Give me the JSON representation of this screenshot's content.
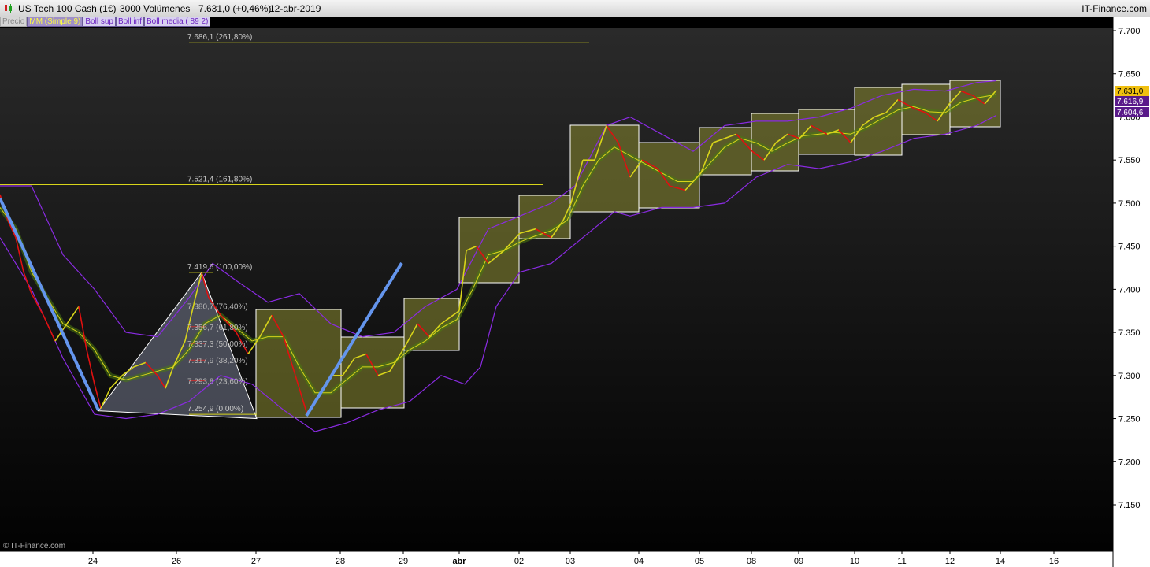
{
  "header": {
    "instrument": "US Tech 100 Cash (1€)",
    "volume": "3000 Volúmenes",
    "price_change": "7.631,0 (+0,46%)",
    "date": "12-abr-2019",
    "brand": "IT-Finance.com"
  },
  "legend": [
    "Precio",
    "MM (Simple 9)",
    "Boll sup",
    "Boll inf",
    "Boll media ( 89 2)"
  ],
  "watermark": "© IT-Finance.com",
  "price_tags": {
    "last": "7.631,0",
    "upper": "7.616,9",
    "lower": "7.604,6"
  },
  "colors": {
    "background_top": "#262626",
    "background_bottom": "#020202",
    "price_up": "#d8d41a",
    "price_down": "#e01010",
    "sma": "#d8d41a",
    "bollinger": "#8a2be2",
    "trend_lines": "#6495ed",
    "boxes_fill": "#8a8a30",
    "fib_line": "#d8d41a"
  },
  "fibonacci": {
    "main_levels": [
      {
        "label": "7.686,1 (261,80%)",
        "value": 7686.1
      },
      {
        "label": "7.521,4 (161,80%)",
        "value": 7521.4
      },
      {
        "label": "7.419,6 (100,00%)",
        "value": 7419.6
      },
      {
        "label": "7.254,9 (0,00%)",
        "value": 7254.9
      }
    ],
    "retracements": [
      {
        "label": "7.380,7 (76,40%)",
        "value": 7380.7
      },
      {
        "label": "7.356,7 (61,80%)",
        "value": 7356.7
      },
      {
        "label": "7.337,3 (50,00%)",
        "value": 7337.3
      },
      {
        "label": "7.317,9 (38,20%)",
        "value": 7317.9
      },
      {
        "label": "7.293,8 (23,60%)",
        "value": 7293.8
      }
    ]
  },
  "chart_data": {
    "type": "line",
    "title": "US Tech 100 Cash (1€)",
    "y_ticks": [
      7700,
      7650,
      7600,
      7550,
      7500,
      7450,
      7400,
      7350,
      7300,
      7250,
      7200,
      7150
    ],
    "y_tick_labels": [
      "7.700",
      "7.650",
      "7.600",
      "7.550",
      "7.500",
      "7.450",
      "7.400",
      "7.350",
      "7.300",
      "7.250",
      "7.200",
      "7.150"
    ],
    "ylim": [
      7095,
      7722
    ],
    "x_tick_labels": [
      "24",
      "26",
      "27",
      "28",
      "29",
      "abr",
      "02",
      "03",
      "04",
      "05",
      "08",
      "09",
      "10",
      "11",
      "12",
      "14",
      "16"
    ],
    "series": [
      {
        "name": "Precio",
        "points": [
          [
            0,
            7510
          ],
          [
            10,
            7480
          ],
          [
            20,
            7460
          ],
          [
            30,
            7420
          ],
          [
            40,
            7395
          ],
          [
            55,
            7370
          ],
          [
            70,
            7340
          ],
          [
            85,
            7360
          ],
          [
            100,
            7380
          ],
          [
            110,
            7330
          ],
          [
            120,
            7290
          ],
          [
            128,
            7262
          ],
          [
            140,
            7285
          ],
          [
            155,
            7300
          ],
          [
            170,
            7310
          ],
          [
            185,
            7315
          ],
          [
            200,
            7300
          ],
          [
            210,
            7285
          ],
          [
            220,
            7310
          ],
          [
            235,
            7340
          ],
          [
            248,
            7390
          ],
          [
            256,
            7419
          ],
          [
            265,
            7390
          ],
          [
            280,
            7370
          ],
          [
            300,
            7350
          ],
          [
            315,
            7325
          ],
          [
            330,
            7345
          ],
          [
            345,
            7370
          ],
          [
            360,
            7345
          ],
          [
            375,
            7300
          ],
          [
            390,
            7255
          ],
          [
            405,
            7275
          ],
          [
            420,
            7300
          ],
          [
            435,
            7300
          ],
          [
            450,
            7320
          ],
          [
            465,
            7325
          ],
          [
            480,
            7300
          ],
          [
            495,
            7305
          ],
          [
            515,
            7335
          ],
          [
            530,
            7360
          ],
          [
            545,
            7345
          ],
          [
            560,
            7360
          ],
          [
            583,
            7375
          ],
          [
            592,
            7445
          ],
          [
            605,
            7450
          ],
          [
            620,
            7430
          ],
          [
            640,
            7445
          ],
          [
            660,
            7465
          ],
          [
            680,
            7470
          ],
          [
            700,
            7460
          ],
          [
            715,
            7480
          ],
          [
            725,
            7500
          ],
          [
            740,
            7550
          ],
          [
            755,
            7550
          ],
          [
            770,
            7590
          ],
          [
            785,
            7570
          ],
          [
            800,
            7530
          ],
          [
            815,
            7550
          ],
          [
            835,
            7540
          ],
          [
            850,
            7520
          ],
          [
            870,
            7515
          ],
          [
            890,
            7535
          ],
          [
            905,
            7570
          ],
          [
            920,
            7575
          ],
          [
            935,
            7580
          ],
          [
            955,
            7560
          ],
          [
            970,
            7550
          ],
          [
            985,
            7570
          ],
          [
            1000,
            7580
          ],
          [
            1015,
            7575
          ],
          [
            1030,
            7590
          ],
          [
            1050,
            7580
          ],
          [
            1065,
            7585
          ],
          [
            1080,
            7570
          ],
          [
            1095,
            7590
          ],
          [
            1110,
            7600
          ],
          [
            1125,
            7605
          ],
          [
            1140,
            7620
          ],
          [
            1160,
            7610
          ],
          [
            1175,
            7605
          ],
          [
            1190,
            7595
          ],
          [
            1205,
            7615
          ],
          [
            1220,
            7630
          ],
          [
            1235,
            7625
          ],
          [
            1250,
            7615
          ],
          [
            1265,
            7631
          ]
        ]
      },
      {
        "name": "MM (Simple 9)",
        "points": [
          [
            0,
            7495
          ],
          [
            20,
            7470
          ],
          [
            40,
            7420
          ],
          [
            60,
            7390
          ],
          [
            80,
            7360
          ],
          [
            100,
            7350
          ],
          [
            120,
            7330
          ],
          [
            140,
            7300
          ],
          [
            160,
            7295
          ],
          [
            180,
            7300
          ],
          [
            200,
            7305
          ],
          [
            220,
            7310
          ],
          [
            240,
            7330
          ],
          [
            260,
            7360
          ],
          [
            280,
            7370
          ],
          [
            300,
            7355
          ],
          [
            320,
            7340
          ],
          [
            340,
            7345
          ],
          [
            360,
            7345
          ],
          [
            380,
            7310
          ],
          [
            400,
            7280
          ],
          [
            420,
            7280
          ],
          [
            440,
            7295
          ],
          [
            460,
            7310
          ],
          [
            480,
            7310
          ],
          [
            500,
            7315
          ],
          [
            520,
            7330
          ],
          [
            540,
            7340
          ],
          [
            560,
            7355
          ],
          [
            580,
            7365
          ],
          [
            600,
            7400
          ],
          [
            620,
            7440
          ],
          [
            640,
            7445
          ],
          [
            660,
            7455
          ],
          [
            680,
            7462
          ],
          [
            700,
            7468
          ],
          [
            720,
            7480
          ],
          [
            740,
            7520
          ],
          [
            760,
            7550
          ],
          [
            780,
            7565
          ],
          [
            800,
            7555
          ],
          [
            820,
            7545
          ],
          [
            840,
            7535
          ],
          [
            860,
            7525
          ],
          [
            880,
            7525
          ],
          [
            900,
            7545
          ],
          [
            920,
            7565
          ],
          [
            940,
            7575
          ],
          [
            960,
            7570
          ],
          [
            980,
            7560
          ],
          [
            1000,
            7570
          ],
          [
            1020,
            7578
          ],
          [
            1040,
            7580
          ],
          [
            1060,
            7582
          ],
          [
            1080,
            7580
          ],
          [
            1100,
            7588
          ],
          [
            1120,
            7598
          ],
          [
            1140,
            7608
          ],
          [
            1160,
            7612
          ],
          [
            1180,
            7606
          ],
          [
            1200,
            7605
          ],
          [
            1220,
            7617
          ],
          [
            1240,
            7622
          ],
          [
            1265,
            7626
          ]
        ]
      },
      {
        "name": "Boll sup",
        "points": [
          [
            0,
            7520
          ],
          [
            40,
            7520
          ],
          [
            80,
            7440
          ],
          [
            120,
            7400
          ],
          [
            160,
            7350
          ],
          [
            200,
            7345
          ],
          [
            240,
            7390
          ],
          [
            270,
            7430
          ],
          [
            300,
            7410
          ],
          [
            340,
            7385
          ],
          [
            380,
            7395
          ],
          [
            420,
            7360
          ],
          [
            460,
            7345
          ],
          [
            500,
            7350
          ],
          [
            540,
            7380
          ],
          [
            580,
            7400
          ],
          [
            620,
            7470
          ],
          [
            660,
            7485
          ],
          [
            700,
            7500
          ],
          [
            730,
            7520
          ],
          [
            770,
            7590
          ],
          [
            800,
            7600
          ],
          [
            840,
            7580
          ],
          [
            880,
            7560
          ],
          [
            920,
            7590
          ],
          [
            960,
            7595
          ],
          [
            1000,
            7595
          ],
          [
            1040,
            7600
          ],
          [
            1080,
            7610
          ],
          [
            1120,
            7625
          ],
          [
            1160,
            7632
          ],
          [
            1200,
            7630
          ],
          [
            1240,
            7640
          ],
          [
            1265,
            7642
          ]
        ]
      },
      {
        "name": "Boll inf",
        "points": [
          [
            0,
            7460
          ],
          [
            40,
            7400
          ],
          [
            80,
            7320
          ],
          [
            120,
            7255
          ],
          [
            160,
            7250
          ],
          [
            200,
            7255
          ],
          [
            240,
            7270
          ],
          [
            280,
            7300
          ],
          [
            320,
            7290
          ],
          [
            360,
            7260
          ],
          [
            400,
            7235
          ],
          [
            440,
            7245
          ],
          [
            480,
            7260
          ],
          [
            520,
            7270
          ],
          [
            560,
            7300
          ],
          [
            590,
            7290
          ],
          [
            610,
            7310
          ],
          [
            630,
            7380
          ],
          [
            660,
            7420
          ],
          [
            700,
            7430
          ],
          [
            740,
            7460
          ],
          [
            780,
            7490
          ],
          [
            800,
            7485
          ],
          [
            840,
            7495
          ],
          [
            880,
            7495
          ],
          [
            920,
            7500
          ],
          [
            960,
            7530
          ],
          [
            1000,
            7545
          ],
          [
            1040,
            7540
          ],
          [
            1080,
            7548
          ],
          [
            1120,
            7560
          ],
          [
            1160,
            7575
          ],
          [
            1200,
            7580
          ],
          [
            1240,
            7590
          ],
          [
            1265,
            7602
          ]
        ]
      }
    ]
  }
}
